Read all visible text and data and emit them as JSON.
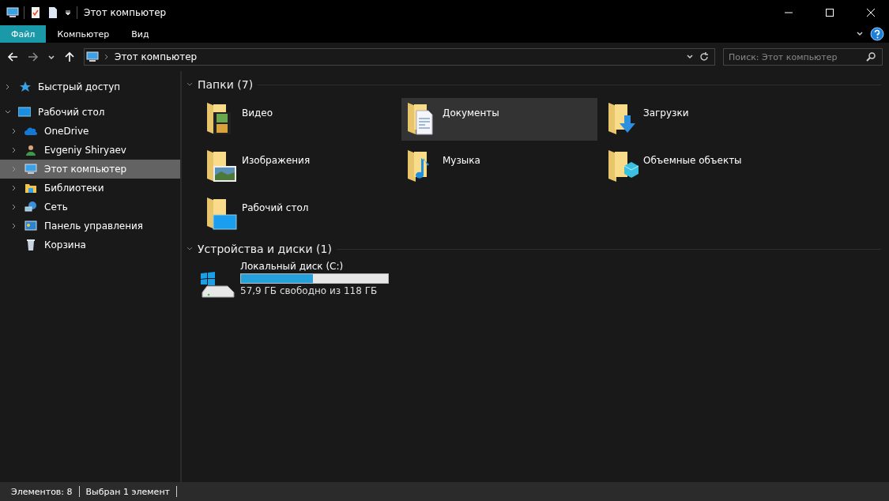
{
  "window": {
    "title": "Этот компьютер"
  },
  "ribbon_tabs": [
    {
      "label": "Файл",
      "selected": true
    },
    {
      "label": "Компьютер",
      "selected": false
    },
    {
      "label": "Вид",
      "selected": false
    }
  ],
  "address": {
    "path": "Этот компьютер"
  },
  "search": {
    "placeholder": "Поиск: Этот компьютер"
  },
  "sidebar": {
    "items": [
      {
        "label": "Быстрый доступ",
        "kind": "star",
        "expandable": true,
        "expanded": false,
        "selected": false
      },
      {
        "label": "Рабочий стол",
        "kind": "desktop",
        "expandable": true,
        "expanded": true,
        "selected": false,
        "children": [
          {
            "label": "OneDrive",
            "kind": "cloud",
            "expandable": true,
            "expanded": false,
            "selected": false
          },
          {
            "label": "Evgeniy Shiryaev",
            "kind": "user",
            "expandable": true,
            "expanded": false,
            "selected": false
          },
          {
            "label": "Этот компьютер",
            "kind": "computer",
            "expandable": true,
            "expanded": false,
            "selected": true
          },
          {
            "label": "Библиотеки",
            "kind": "library",
            "expandable": true,
            "expanded": false,
            "selected": false
          },
          {
            "label": "Сеть",
            "kind": "network",
            "expandable": true,
            "expanded": false,
            "selected": false
          },
          {
            "label": "Панель управления",
            "kind": "control",
            "expandable": true,
            "expanded": false,
            "selected": false
          },
          {
            "label": "Корзина",
            "kind": "bin",
            "expandable": false,
            "selected": false
          }
        ]
      }
    ]
  },
  "folders": {
    "heading": "Папки (7)",
    "items": [
      {
        "name": "Видео",
        "kind": "video",
        "selected": false
      },
      {
        "name": "Документы",
        "kind": "documents",
        "selected": true
      },
      {
        "name": "Загрузки",
        "kind": "downloads",
        "selected": false
      },
      {
        "name": "Изображения",
        "kind": "pictures",
        "selected": false
      },
      {
        "name": "Музыка",
        "kind": "music",
        "selected": false
      },
      {
        "name": "Объемные объекты",
        "kind": "objects",
        "selected": false
      },
      {
        "name": "Рабочий стол",
        "kind": "desktop",
        "selected": false
      }
    ]
  },
  "devices": {
    "heading": "Устройства и диски (1)",
    "items": [
      {
        "name": "Локальный диск (C:)",
        "level": 0.49,
        "free": "57,9 ГБ свободно из 118 ГБ"
      }
    ]
  },
  "status_bar": {
    "items_count": "Элементов: 8",
    "selection": "Выбран 1 элемент"
  }
}
